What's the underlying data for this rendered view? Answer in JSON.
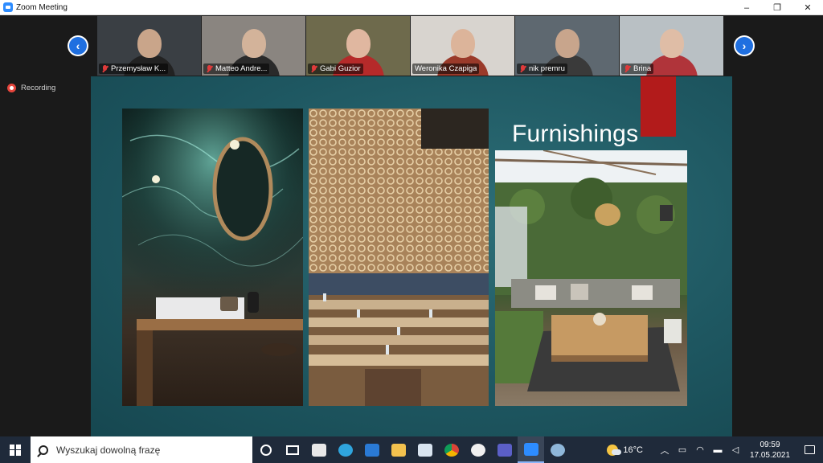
{
  "window": {
    "title": "Zoom Meeting",
    "minimize": "–",
    "restore": "❐",
    "close": "✕"
  },
  "participants": [
    {
      "name": "Przemysław K...",
      "muted": true,
      "bg": "#3a3f44",
      "skin": "#c9a58a",
      "shirt": "#222222"
    },
    {
      "name": "Matteo Andre...",
      "muted": true,
      "bg": "#8a8580",
      "skin": "#d3b39a",
      "shirt": "#2a2a2a"
    },
    {
      "name": "Gabi Guzior",
      "muted": true,
      "bg": "#6e6a4c",
      "skin": "#e0b7a0",
      "shirt": "#b52a2a"
    },
    {
      "name": "Weronika Czapiga",
      "muted": false,
      "active": true,
      "bg": "#d8d4cf",
      "skin": "#dcb49a",
      "shirt": "#9a3a2a"
    },
    {
      "name": "nik premru",
      "muted": true,
      "bg": "#5e6870",
      "skin": "#c8a58c",
      "shirt": "#3a3a3a"
    },
    {
      "name": "Brina",
      "muted": true,
      "bg": "#b9c0c4",
      "skin": "#dfbda6",
      "shirt": "#b0343a"
    }
  ],
  "nav": {
    "prev": "‹",
    "next": "›"
  },
  "recording": {
    "label": "Recording"
  },
  "slide": {
    "title": "Furnishings"
  },
  "taskbar": {
    "search_placeholder": "Wyszukaj dowolną frazę",
    "weather": "16°C",
    "time": "09:59",
    "date": "17.05.2021"
  }
}
